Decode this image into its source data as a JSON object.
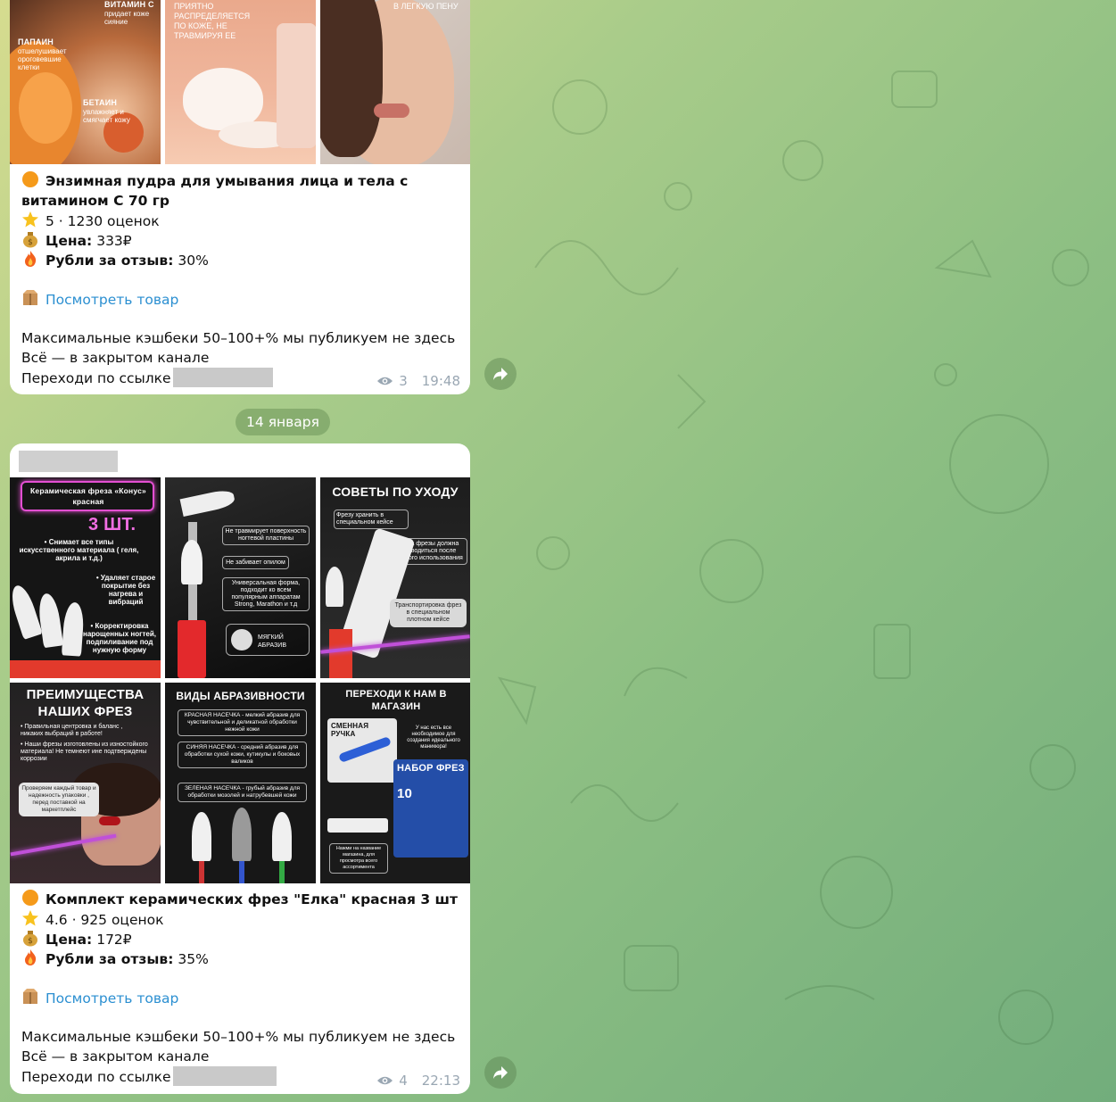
{
  "date_separator": "14 января",
  "messages": [
    {
      "title": "Энзимная пудра для умывания лица и тела с витамином С 70 гр",
      "rating": "5 · 1230 оценок",
      "price_label": "Цена:",
      "price_value": "333₽",
      "reward_label": "Рубли за отзыв:",
      "reward_value": "30%",
      "link_text": "Посмотреть товар",
      "footer_line1": "Максимальные кэшбеки 50–100+% мы публикуем не здесь",
      "footer_line2": "Всё — в закрытом канале",
      "footer_line3": "Переходи по ссылке",
      "views": "3",
      "time": "19:48",
      "tiles": {
        "t1_vitamin": "ВИТАМИН С",
        "t1_vitamin_sub": "придает коже сияние",
        "t1_papain": "ПАПАИН",
        "t1_papain_sub": "отшелушивает ороговевшие клетки",
        "t1_betain": "БЕТАИН",
        "t1_betain_sub": "увлажняет и смягчает кожу",
        "t2_text": "ПРИЯТНО РАСПРЕДЕЛЯЕТСЯ ПО КОЖЕ, НЕ ТРАВМИРУЯ ЕЕ",
        "t3_text": "В ЛЕГКУЮ ПЕНУ"
      }
    },
    {
      "title": "Комплект керамических фрез \"Елка\" красная 3 шт",
      "rating": "4.6 · 925 оценок",
      "price_label": "Цена:",
      "price_value": "172₽",
      "reward_label": "Рубли за отзыв:",
      "reward_value": "35%",
      "link_text": "Посмотреть товар",
      "footer_line1": "Максимальные кэшбеки 50–100+% мы публикуем не здесь",
      "footer_line2": "Всё — в закрытом канале",
      "footer_line3": "Переходи по ссылке",
      "views": "4",
      "time": "22:13",
      "tiles": {
        "a_title": "Керамическая фреза «Конус» красная",
        "a_count": "3 ШТ.",
        "a_b1": "• Снимает все типы искусственного материала ( геля, акрила и т.д.)",
        "a_b2": "• Удаляет старое покрытие без нагрева и вибраций",
        "a_b3": "• Корректировка нарощенных ногтей, подпиливание под нужную форму",
        "b_1": "Не травмирует поверхность ногтевой пластины",
        "b_2": "Не забивает опилом",
        "b_3": "Универсальная форма, подходит ко всем популярным аппаратам Strong, Marathon и т.д",
        "b_4": "МЯГКИЙ АБРАЗИВ",
        "c_title": "СОВЕТЫ ПО УХОДУ",
        "c_1": "Фрезу хранить в специальном кейсе",
        "c_2": "Чистка фрезы должна производиться после каждого использования",
        "c_3": "Транспортировка фрез в специальном плотном кейсе",
        "d_title": "ПРЕИМУЩЕСТВА НАШИХ ФРЕЗ",
        "d_1": "• Правильная центровка и баланс , никаких выбраций в работе!",
        "d_2": "• Наши фрезы изготовлены из изностойкого материала! Не темнеют ине подтверждены коррозии",
        "d_3": "Проверяем каждый товар и надежность упаковки , перед поставкой на маркетплейс",
        "e_title": "ВИДЫ АБРАЗИВНОСТИ",
        "e_1": "КРАСНАЯ НАСЕЧКА - мелкий абразив для чувствительной и деликатной обработки нежной кожи",
        "e_2": "СИНЯЯ НАСЕЧКА - средний абразив для обработки сухой кожи, кутикулы и боковых валиков",
        "e_3": "ЗЕЛЕНАЯ НАСЕЧКА - грубый абразив для обработки мозолей и натрубевшей кожи",
        "f_title": "ПЕРЕХОДИ К НАМ В МАГАЗИН",
        "f_1": "СМЕННАЯ РУЧКА",
        "f_2": "У нас есть все необходимое для создания идеального маникюра!",
        "f_3": "НАБОР ФРЕЗ",
        "f_4": "10",
        "f_5": "Нажми на название магазина, для просмотра всего ассортимента"
      }
    }
  ],
  "colors": {
    "link": "#2b8fd1",
    "meta": "#9aa7b3",
    "bubble": "#ffffff"
  }
}
